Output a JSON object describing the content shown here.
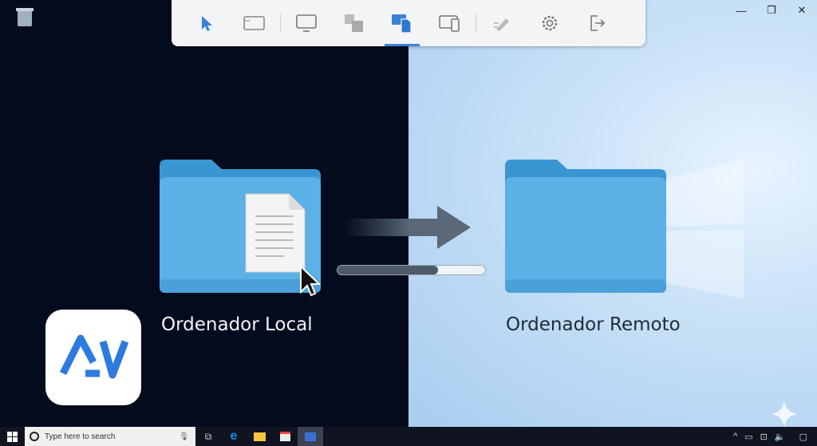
{
  "toolbar": {
    "items": [
      "pointer-icon",
      "window-icon",
      "monitor-icon",
      "switch-screens-icon",
      "file-transfer-icon",
      "devices-icon",
      "tools-icon",
      "settings-icon",
      "exit-icon"
    ],
    "active_index": 4,
    "accent": "#3b82d6"
  },
  "local": {
    "label": "Ordenador Local"
  },
  "remote": {
    "label": "Ordenador Remoto"
  },
  "transfer": {
    "progress_percent": 68
  },
  "taskbar": {
    "search_placeholder": "Type here to search"
  },
  "colors": {
    "folder": "#5bb0e6",
    "dark_bg": "#040b1c"
  }
}
